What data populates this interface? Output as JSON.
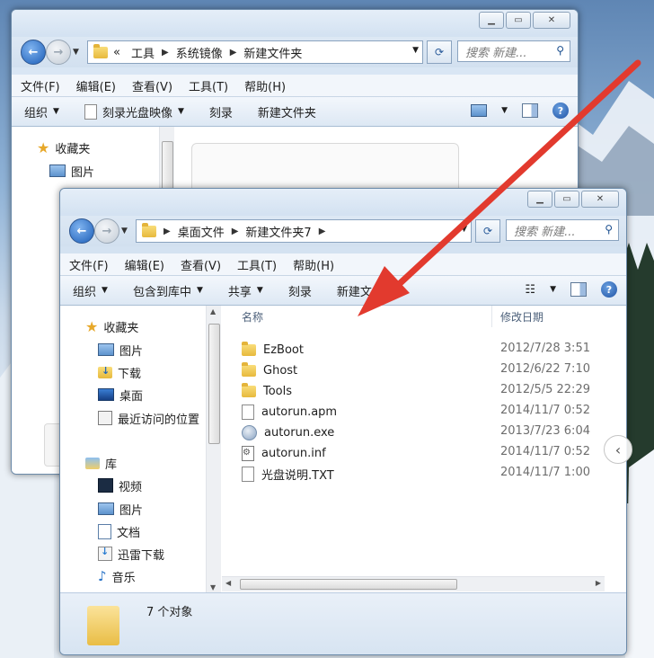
{
  "back_window": {
    "address": [
      "«",
      "工具",
      "系统镜像",
      "新建文件夹"
    ],
    "search_placeholder": "搜索 新建...",
    "menu": [
      "文件(F)",
      "编辑(E)",
      "查看(V)",
      "工具(T)",
      "帮助(H)"
    ],
    "toolbar": [
      "组织",
      "刻录光盘映像",
      "刻录",
      "新建文件夹"
    ],
    "nav": {
      "favorites": "收藏夹",
      "pictures": "图片"
    }
  },
  "front_window": {
    "address": [
      "桌面文件",
      "新建文件夹7"
    ],
    "search_placeholder": "搜索 新建...",
    "menu": [
      "文件(F)",
      "编辑(E)",
      "查看(V)",
      "工具(T)",
      "帮助(H)"
    ],
    "toolbar": [
      "组织",
      "包含到库中",
      "共享",
      "刻录",
      "新建文件夹"
    ],
    "nav_pane": {
      "favorites": "收藏夹",
      "favorites_items": [
        "图片",
        "下载",
        "桌面",
        "最近访问的位置"
      ],
      "libraries": "库",
      "library_items": [
        "视频",
        "图片",
        "文档",
        "迅雷下载",
        "音乐"
      ]
    },
    "columns": {
      "name": "名称",
      "date": "修改日期"
    },
    "files": [
      {
        "name": "EzBoot",
        "date": "2012/7/28 3:51",
        "icon": "folder-icon"
      },
      {
        "name": "Ghost",
        "date": "2012/6/22 7:10",
        "icon": "folder-icon"
      },
      {
        "name": "Tools",
        "date": "2012/5/5 22:29",
        "icon": "folder-icon"
      },
      {
        "name": "autorun.apm",
        "date": "2014/11/7 0:52",
        "icon": "file-icon"
      },
      {
        "name": "autorun.exe",
        "date": "2013/7/23 6:04",
        "icon": "exe-icon"
      },
      {
        "name": "autorun.inf",
        "date": "2014/11/7 0:52",
        "icon": "settings-file-icon"
      },
      {
        "name": "光盘说明.TXT",
        "date": "2014/11/7 1:00",
        "icon": "text-file-icon"
      }
    ],
    "status": "7 个对象"
  }
}
